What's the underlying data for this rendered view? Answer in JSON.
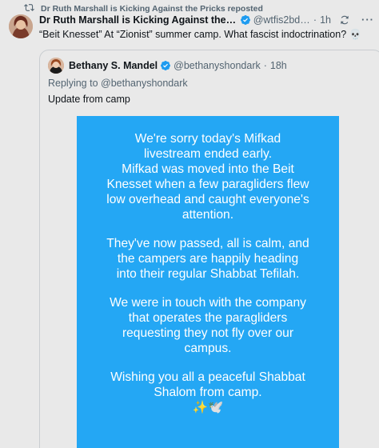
{
  "repost": {
    "icon": "repost-icon",
    "text": "Dr Ruth Marshall is Kicking Against the Pricks reposted"
  },
  "tweet": {
    "author_name": "Dr Ruth Marshall is Kicking Against the Pri...",
    "handle": "@wtfis2bdo...",
    "separator": "·",
    "time": "1h",
    "text": "“Beit Knesset” At “Zionist” summer camp. What fascist indoctrination? 💀"
  },
  "quote": {
    "author_name": "Bethany S. Mandel",
    "handle": "@bethanyshondark",
    "separator": "·",
    "time": "18h",
    "replying_prefix": "Replying to",
    "replying_handle": "@bethanyshondark",
    "text": "Update from camp",
    "image_lines": {
      "p1": [
        "We're sorry today's Mifkad",
        "livestream ended early.",
        "Mifkad was moved into the Beit",
        "Knesset when a few paragliders flew",
        "low overhead and caught everyone's",
        "attention."
      ],
      "p2": [
        "They've now passed, all is calm, and",
        "the campers are happily heading",
        "into their regular Shabbat Tefilah."
      ],
      "p3": [
        "We were in touch with the company",
        "that operates the paragliders",
        "requesting they not fly over our",
        "campus."
      ],
      "p4": [
        "Wishing you all a peaceful Shabbat",
        "Shalom from camp.",
        "✨🕊️"
      ]
    }
  },
  "colors": {
    "background": "#e9e9e9",
    "verified_blue": "#1d9bf0",
    "image_blue": "#24a7f4",
    "secondary_text": "#536471"
  }
}
